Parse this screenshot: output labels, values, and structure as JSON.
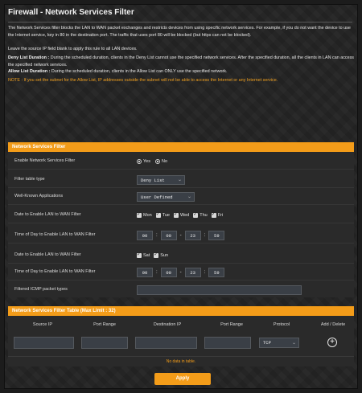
{
  "page": {
    "title": "Firewall - Network Services Filter"
  },
  "description": {
    "p1": "The Network Services filter blocks the LAN to WAN packet exchanges and restricts devices from using specific network services. For example, if you do not want the device to use the Internet service, key in 80 in the destination port. The traffic that uses port 80 will be blocked (but https can not be blocked).",
    "p2": "Leave the source IP field blank to apply this rule to all LAN devices.",
    "deny_label": "Deny List Duration :",
    "deny_text": " During the scheduled duration, clients in the Deny List cannot use the specified network services. After the specified duration, all the clients in LAN can access the specified network services.",
    "allow_label": "Allow List Duration :",
    "allow_text": " During the scheduled duration, clients in the Allow List can ONLY use the specified network.",
    "note": "NOTE : If you set the subnet for the Allow List, IP addresses outside the subnet will not be able to access the Internet or any Internet service."
  },
  "filter_section": {
    "header": "Network Services Filter",
    "enable": {
      "label": "Enable Network Services Filter",
      "yes": "Yes",
      "no": "No",
      "selected": "No"
    },
    "table_type": {
      "label": "Filter table type",
      "value": "Deny List"
    },
    "apps": {
      "label": "Well-Known Applications",
      "value": "User Defined"
    },
    "weekday_date": {
      "label": "Date to Enable LAN to WAN Filter",
      "days": [
        {
          "name": "Mon",
          "checked": true
        },
        {
          "name": "Tue",
          "checked": true
        },
        {
          "name": "Wed",
          "checked": true
        },
        {
          "name": "Thu",
          "checked": true
        },
        {
          "name": "Fri",
          "checked": true
        }
      ]
    },
    "weekday_time": {
      "label": "Time of Day to Enable LAN to WAN Filter",
      "from_h": "00",
      "from_m": "00",
      "to_h": "23",
      "to_m": "59"
    },
    "weekend_date": {
      "label": "Date to Enable LAN to WAN Filter",
      "days": [
        {
          "name": "Sat",
          "checked": true
        },
        {
          "name": "Sun",
          "checked": true
        }
      ]
    },
    "weekend_time": {
      "label": "Time of Day to Enable LAN to WAN Filter",
      "from_h": "00",
      "from_m": "00",
      "to_h": "23",
      "to_m": "59"
    },
    "icmp": {
      "label": "Filtered ICMP packet types",
      "value": ""
    }
  },
  "table_section": {
    "header": "Network Services Filter Table (Max Limit : 32)",
    "columns": [
      "Source IP",
      "Port Range",
      "Destination IP",
      "Port Range",
      "Protocol",
      "Add / Delete"
    ],
    "protocol_value": "TCP",
    "empty_text": "No data in table."
  },
  "apply_label": "Apply",
  "colors": {
    "accent": "#f39c19",
    "background": "#232323",
    "input": "#3a3f46"
  },
  "icons": {
    "add": "plus-circle-icon",
    "dropdown": "chevron-down-icon"
  }
}
